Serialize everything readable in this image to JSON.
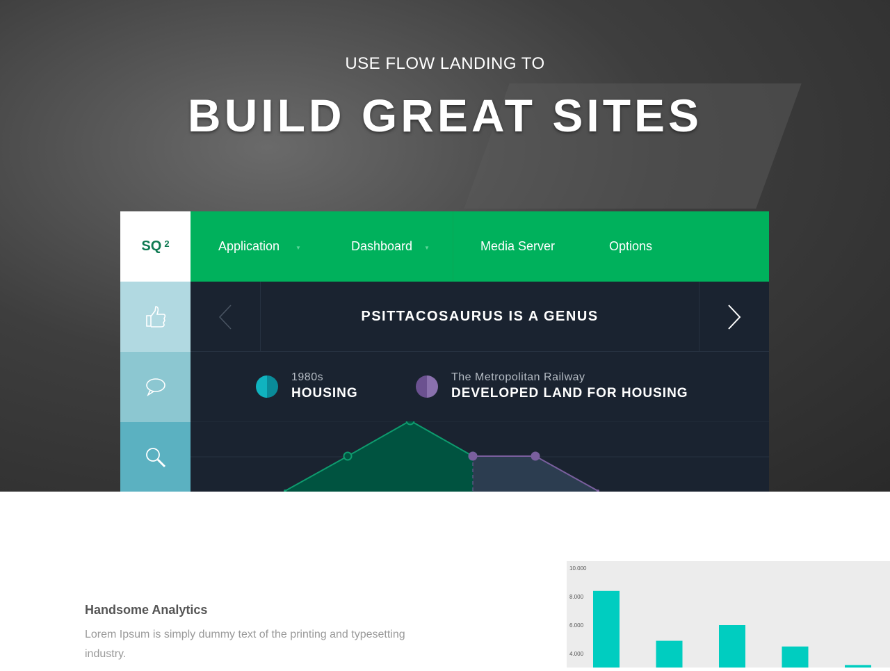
{
  "hero": {
    "subtitle": "USE FLOW LANDING TO",
    "title": "BUILD GREAT SITES"
  },
  "panel": {
    "logo": {
      "text": "SQ",
      "sup": "2"
    },
    "nav": [
      {
        "label": "Application",
        "dropdown": true
      },
      {
        "label": "Dashboard",
        "dropdown": true
      },
      {
        "label": "Media Server"
      },
      {
        "label": "Options"
      }
    ],
    "sidebar_icons": [
      "thumbs-up-icon",
      "speech-bubble-icon",
      "search-icon"
    ],
    "heading": "PSITTACOSAURUS IS A GENUS",
    "legend": [
      {
        "small": "1980s",
        "big": "HOUSING",
        "color": "#0e9aa7"
      },
      {
        "small": "The Metropolitan Railway",
        "big": "DEVELOPED LAND FOR HOUSING",
        "color": "#7a5f9e"
      }
    ],
    "colors": {
      "green": "#00b15c",
      "dark": "#1a2330"
    }
  },
  "area_chart": {
    "type": "area",
    "series": [
      {
        "values": [
          1,
          2,
          3,
          2
        ],
        "x": [
          0,
          1,
          2,
          3
        ],
        "color": "#00a46b"
      },
      {
        "values": [
          2,
          2,
          1
        ],
        "x": [
          3,
          4,
          5
        ],
        "color": "#7a5f9e"
      }
    ]
  },
  "section": {
    "title": "Handsome Analytics",
    "text": "Lorem Ipsum is simply dummy text of the printing and typesetting industry."
  },
  "chart_data": {
    "type": "bar",
    "yticks": [
      "10.000",
      "8.000",
      "6.000",
      "4.000"
    ],
    "ylim": [
      0,
      10000
    ],
    "values": [
      8400,
      4900,
      6000,
      4500,
      3200
    ],
    "color": "#00cdc0"
  }
}
